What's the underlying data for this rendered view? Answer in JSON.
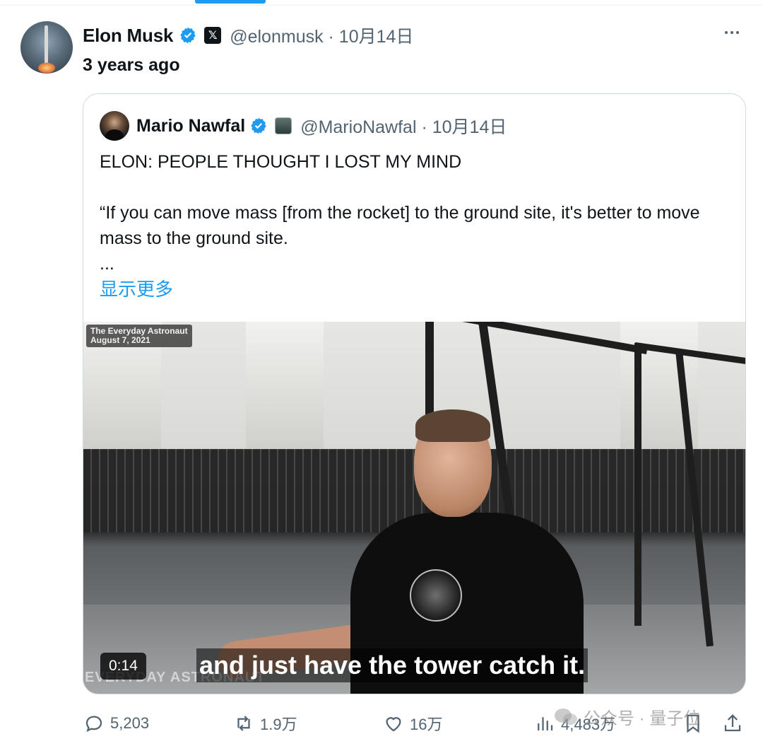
{
  "tweet": {
    "author_name": "Elon Musk",
    "author_handle": "@elonmusk · 10月14日",
    "x_badge": "𝕏",
    "relative_time": "3 years ago"
  },
  "quoted": {
    "author_name": "Mario Nawfal",
    "author_handle": "@MarioNawfal · 10月14日",
    "line1": "ELON: PEOPLE THOUGHT I LOST MY MIND",
    "line2": "“If you can move mass [from the rocket] to the ground site, it's better to move mass to the ground site.",
    "line3": "...",
    "show_more": "显示更多",
    "video": {
      "watermark_line1": "The Everyday Astronaut",
      "watermark_line2": "August 7, 2021",
      "duration": "0:14",
      "subtitle": "and just have the tower catch it.",
      "bottom_logo": "EVERYDAY ASTRONAUT"
    }
  },
  "actions": {
    "replies": "5,203",
    "reposts": "1.9万",
    "likes": "16万",
    "views": "4,483万"
  },
  "overlay": {
    "wechat_label": "公众号 · 量子位"
  },
  "colors": {
    "accent": "#1d9bf0",
    "secondary_text": "#536471",
    "border": "#cfd9de"
  }
}
